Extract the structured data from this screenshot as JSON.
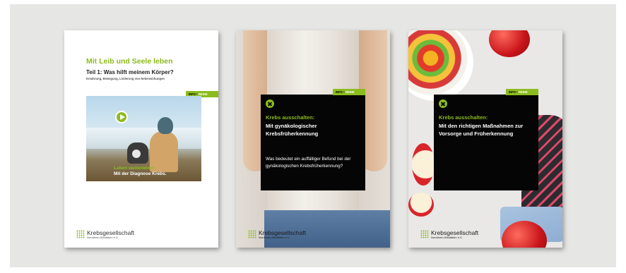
{
  "brand": {
    "name": "Krebsgesellschaft",
    "sub": "Nordrhein-Westfalen e.V."
  },
  "info_tab": {
    "info": "INFO",
    "sep": " • ",
    "reihe": "REIHE"
  },
  "card1": {
    "title": "Mit Leib und Seele leben",
    "subtitle": "Teil 1: Was hilft meinem Körper?",
    "topics": "Ernährung, Bewegung, Linderung von Nebenwirkungen",
    "caption_green": "Leben weiterleben:",
    "caption_white": "Mit der Diagnose Krebs."
  },
  "card2": {
    "kicker": "Krebs ausschalten:",
    "heading": "Mit gynäkologischer Krebsfrüherkennung",
    "question": "Was bedeutet ein auffälliger Befund bei der gynäkologischen Krebsfrüherkennung?"
  },
  "card3": {
    "kicker": "Krebs ausschalten:",
    "heading": "Mit den richtigen Maßnahmen zur Vorsorge und Früherkennung"
  },
  "colors": {
    "accent": "#8cbc1e",
    "box": "#050505",
    "stage": "#e6e6e4"
  }
}
